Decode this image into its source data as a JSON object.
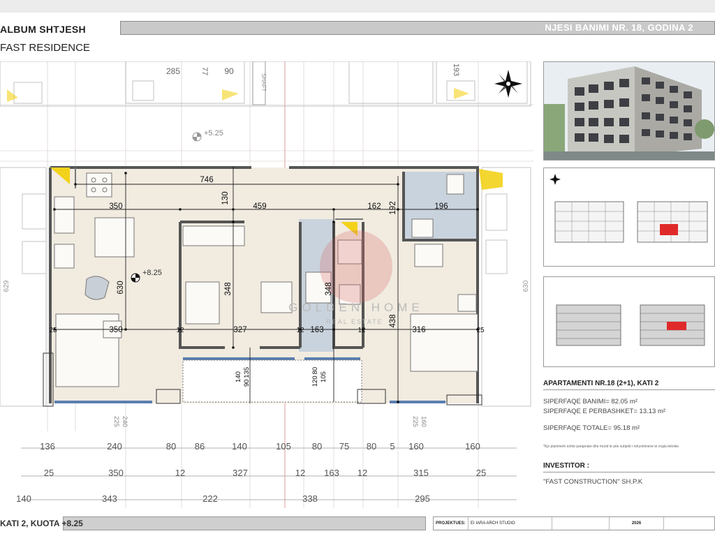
{
  "header": {
    "album_title": "ALBUM SHTJESH",
    "project_name": "FAST RESIDENCE",
    "unit_title": "NJESI BANIMI NR. 18, GODINA 2"
  },
  "plan": {
    "level_marker_top": "+5.25",
    "level_marker_unit": "+8.25",
    "shaft_label": "SHAFT",
    "watermark_brand": "GOLDEN HOME",
    "watermark_sub": "REAL ESTATE",
    "top_dims": [
      "285",
      "77",
      "90",
      "193"
    ],
    "inner_dims": {
      "width_total": "746",
      "left_room": "350",
      "center_span": "459",
      "right_top": "162",
      "bath_width": "196",
      "height_130": "130",
      "height_192": "192",
      "left_height": "630",
      "room_height": "348",
      "bath_height": "348",
      "right_height": "438",
      "bottom_left": "350",
      "bottom_center": "327",
      "bottom_bath": "163",
      "bottom_right": "316",
      "wall_12a": "12",
      "wall_12b": "12",
      "wall_12c": "12",
      "wall_25a": "25",
      "wall_25b": "25",
      "side_left": "629",
      "side_right": "630"
    },
    "window_dims": {
      "w1_top": "140",
      "w1_bottom": "90 135",
      "w2_top": "120 80",
      "w2_bottom": "105",
      "lower_left_a": "240",
      "lower_left_b": "225",
      "lower_right_a": "160",
      "lower_right_b": "225"
    },
    "dim_row_1": [
      "136",
      "240",
      "80",
      "86",
      "140",
      "105",
      "80",
      "75",
      "80",
      "5",
      "160",
      "160"
    ],
    "dim_row_2": [
      "25",
      "350",
      "12",
      "327",
      "12",
      "163",
      "12",
      "315",
      "25"
    ],
    "dim_row_3": [
      "140",
      "343",
      "222",
      "338",
      "295"
    ]
  },
  "apartment": {
    "title": "APARTAMENTI NR.18 (2+1), KATI 2",
    "living_area": "SIPERFAQE BANIMI=  82.05 m²",
    "common_area": "SIPERFAQE E PERBASHKET=  13.13 m²",
    "total_area": "SIPERFAQE TOTALE=  95.18 m²",
    "note": "*Kjo planimetri eshte paraprake dhe mund te jete subjekt i ndryshimeve te vogla teknike"
  },
  "investor": {
    "title": "INVESTITOR :",
    "name": "\"FAST CONSTRUCTION\" SH.P.K"
  },
  "footer": {
    "level_label": "KATI 2, KUOTA +8.25",
    "projektues_label": "PROJEKTUES:",
    "studio": "EI IARA ARCH STUDIO",
    "year": "2026"
  },
  "colors": {
    "floor": "#f1ebe0",
    "bath": "#c9d3dd",
    "wall": "#555555",
    "dimension": "#222222",
    "accent_yellow": "#f3d21b",
    "watermark": "#d96b6b",
    "header_bar": "#c9c9c9"
  }
}
